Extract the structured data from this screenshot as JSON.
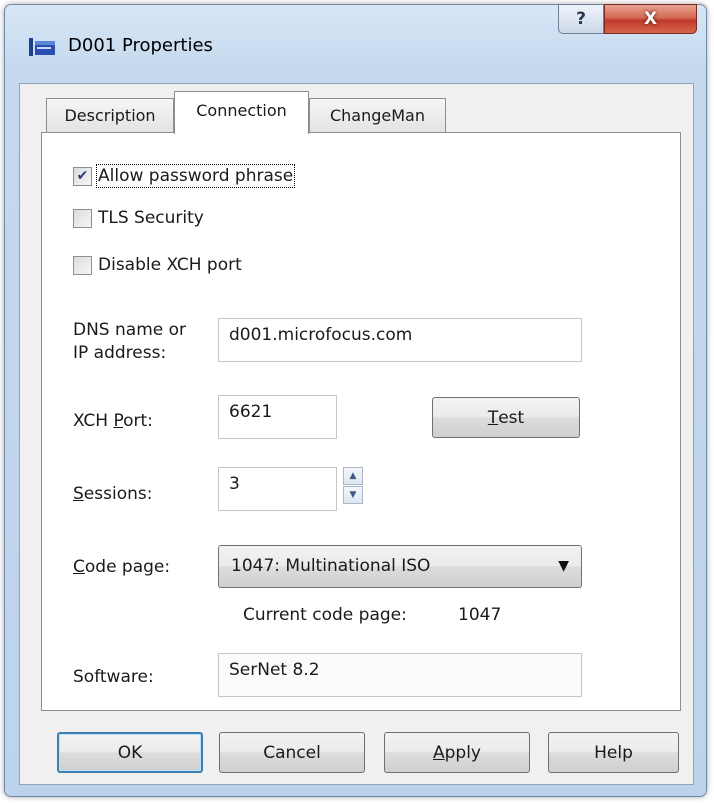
{
  "window": {
    "title": "D001 Properties",
    "help_glyph": "?",
    "close_glyph": "X"
  },
  "tabs": [
    {
      "label": "Description"
    },
    {
      "label": "Connection",
      "active": true
    },
    {
      "label": "ChangeMan"
    }
  ],
  "connection": {
    "allow_password_phrase": {
      "label": "Allow password phrase",
      "checked": true
    },
    "tls_security": {
      "label": "TLS Security",
      "checked": false
    },
    "disable_xch_port": {
      "label": "Disable XCH port",
      "checked": false
    },
    "dns_label_line1": "DNS name or",
    "dns_label_line2": "IP address:",
    "dns_value": "d001.microfocus.com",
    "xch_port_label_pre": "XCH ",
    "xch_port_label_key": "P",
    "xch_port_label_post": "ort:",
    "xch_port_value": "6621",
    "test_label_key": "T",
    "test_label_rest": "est",
    "sessions_label_key": "S",
    "sessions_label_rest": "essions:",
    "sessions_value": "3",
    "code_page_label_key": "C",
    "code_page_label_rest": "ode page:",
    "code_page_value": "1047: Multinational ISO",
    "current_code_page_label": "Current code page:",
    "current_code_page_value": "1047",
    "software_label": "Software:",
    "software_value": "SerNet 8.2"
  },
  "buttons": {
    "ok": "OK",
    "cancel": "Cancel",
    "apply_key": "A",
    "apply_rest": "pply",
    "help": "Help"
  },
  "icons": {
    "app": "dataset-icon",
    "help": "question-icon",
    "close": "close-x-icon",
    "check": "checkmark-icon",
    "spin_up": "spin-up-icon",
    "spin_down": "spin-down-icon",
    "dropdown": "dropdown-arrow-icon"
  },
  "colors": {
    "title_gradient_top": "#d7e6f6",
    "close_button": "#c0392b",
    "default_button_border": "#3c7fb1",
    "checkmark": "#2a3b8f"
  }
}
